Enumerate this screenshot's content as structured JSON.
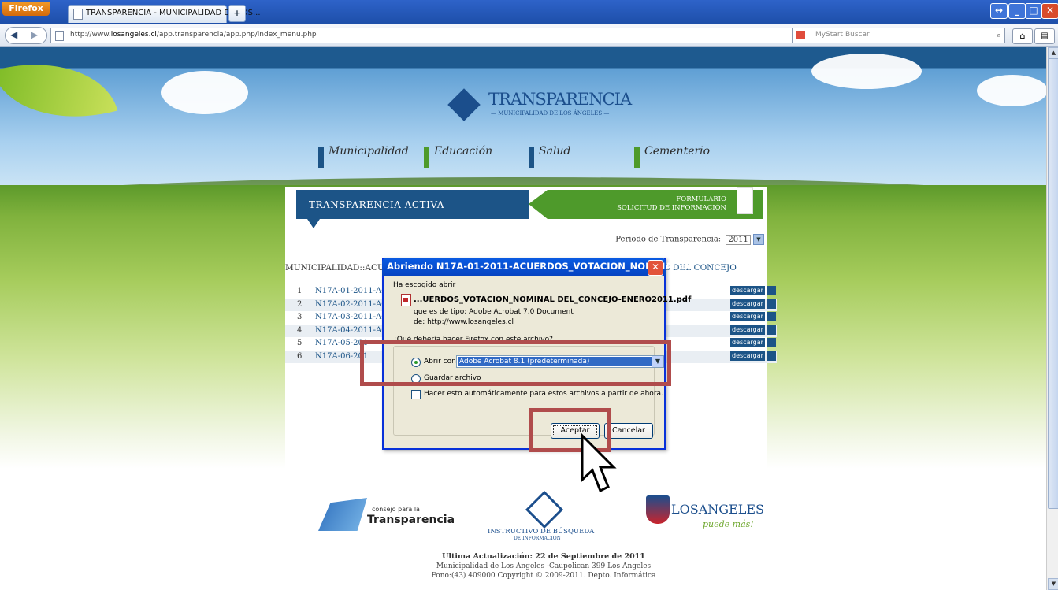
{
  "browser": {
    "menu_label": "Firefox",
    "tab_title": "TRANSPARENCIA - MUNICIPALIDAD DE LOS...",
    "new_tab": "+",
    "url_prefix": "http://www.",
    "url_domain": "losangeles.cl",
    "url_path": "/app.transparencia/app.php/index_menu.php",
    "search_placeholder": "MyStart Buscar"
  },
  "site": {
    "logo_title": "TRANSPARENCIA",
    "logo_subtitle": "— MUNICIPALIDAD DE LOS ÁNGELES —",
    "nav": [
      {
        "label": "Municipalidad",
        "color": "#1c5487"
      },
      {
        "label": "Educación",
        "color": "#4e9a2b"
      },
      {
        "label": "Salud",
        "color": "#1c5487"
      },
      {
        "label": "Cementerio",
        "color": "#4e9a2b"
      }
    ],
    "banner_left": "TRANSPARENCIA ACTIVA",
    "banner_right_line1": "FORMULARIO",
    "banner_right_line2": "SOLICITUD DE INFORMACIÓN",
    "periodo_label": "Periodo de Transparencia:",
    "periodo_value": "2011",
    "section_left": "MUNICIPALIDAD::ACU",
    "section_right": "OS DEL CONCEJO",
    "download_label": "descargar",
    "rows": [
      {
        "num": "1",
        "name": "N17A-01-2011-ACU"
      },
      {
        "num": "2",
        "name": "N17A-02-2011-ACU"
      },
      {
        "num": "3",
        "name": "N17A-03-2011-ACU"
      },
      {
        "num": "4",
        "name": "N17A-04-2011-ACU"
      },
      {
        "num": "5",
        "name": "N17A-05-201"
      },
      {
        "num": "6",
        "name": "N17A-06-201"
      }
    ],
    "cpt_line1": "consejo para la",
    "cpt_line2": "Transparencia",
    "instructivo_line1": "INSTRUCTIVO DE BÚSQUEDA",
    "instructivo_line2": "DE INFORMACIÓN",
    "la_line1": "LOSANGELES",
    "la_line2": "puede más!",
    "footer_updated": "Ultima Actualización: 22 de Septiembre de 2011",
    "footer_address": "Municipalidad de Los Angeles -Caupolican 399 Los Angeles",
    "footer_copy": "Fono:(43) 409000 Copyright © 2009-2011. Depto. Informática"
  },
  "dialog": {
    "title": "Abriendo N17A-01-2011-ACUERDOS_VOTACION_NOMINAL DE...",
    "close": "✕",
    "intro": "Ha escogido abrir",
    "filename": "...UERDOS_VOTACION_NOMINAL DEL_CONCEJO-ENERO2011.pdf",
    "type_line": "que es de tipo:  Adobe Acrobat 7.0 Document",
    "from_line": "de:  http://www.losangeles.cl",
    "question": "¿Qué debería hacer Firefox con este archivo?",
    "open_with_label": "Abrir con",
    "open_with_value": "Adobe Acrobat 8.1 (predeterminada)",
    "save_label": "Guardar archivo",
    "auto_label": "Hacer esto automáticamente para estos archivos a partir de ahora.",
    "ok_label": "Aceptar",
    "cancel_label": "Cancelar"
  }
}
